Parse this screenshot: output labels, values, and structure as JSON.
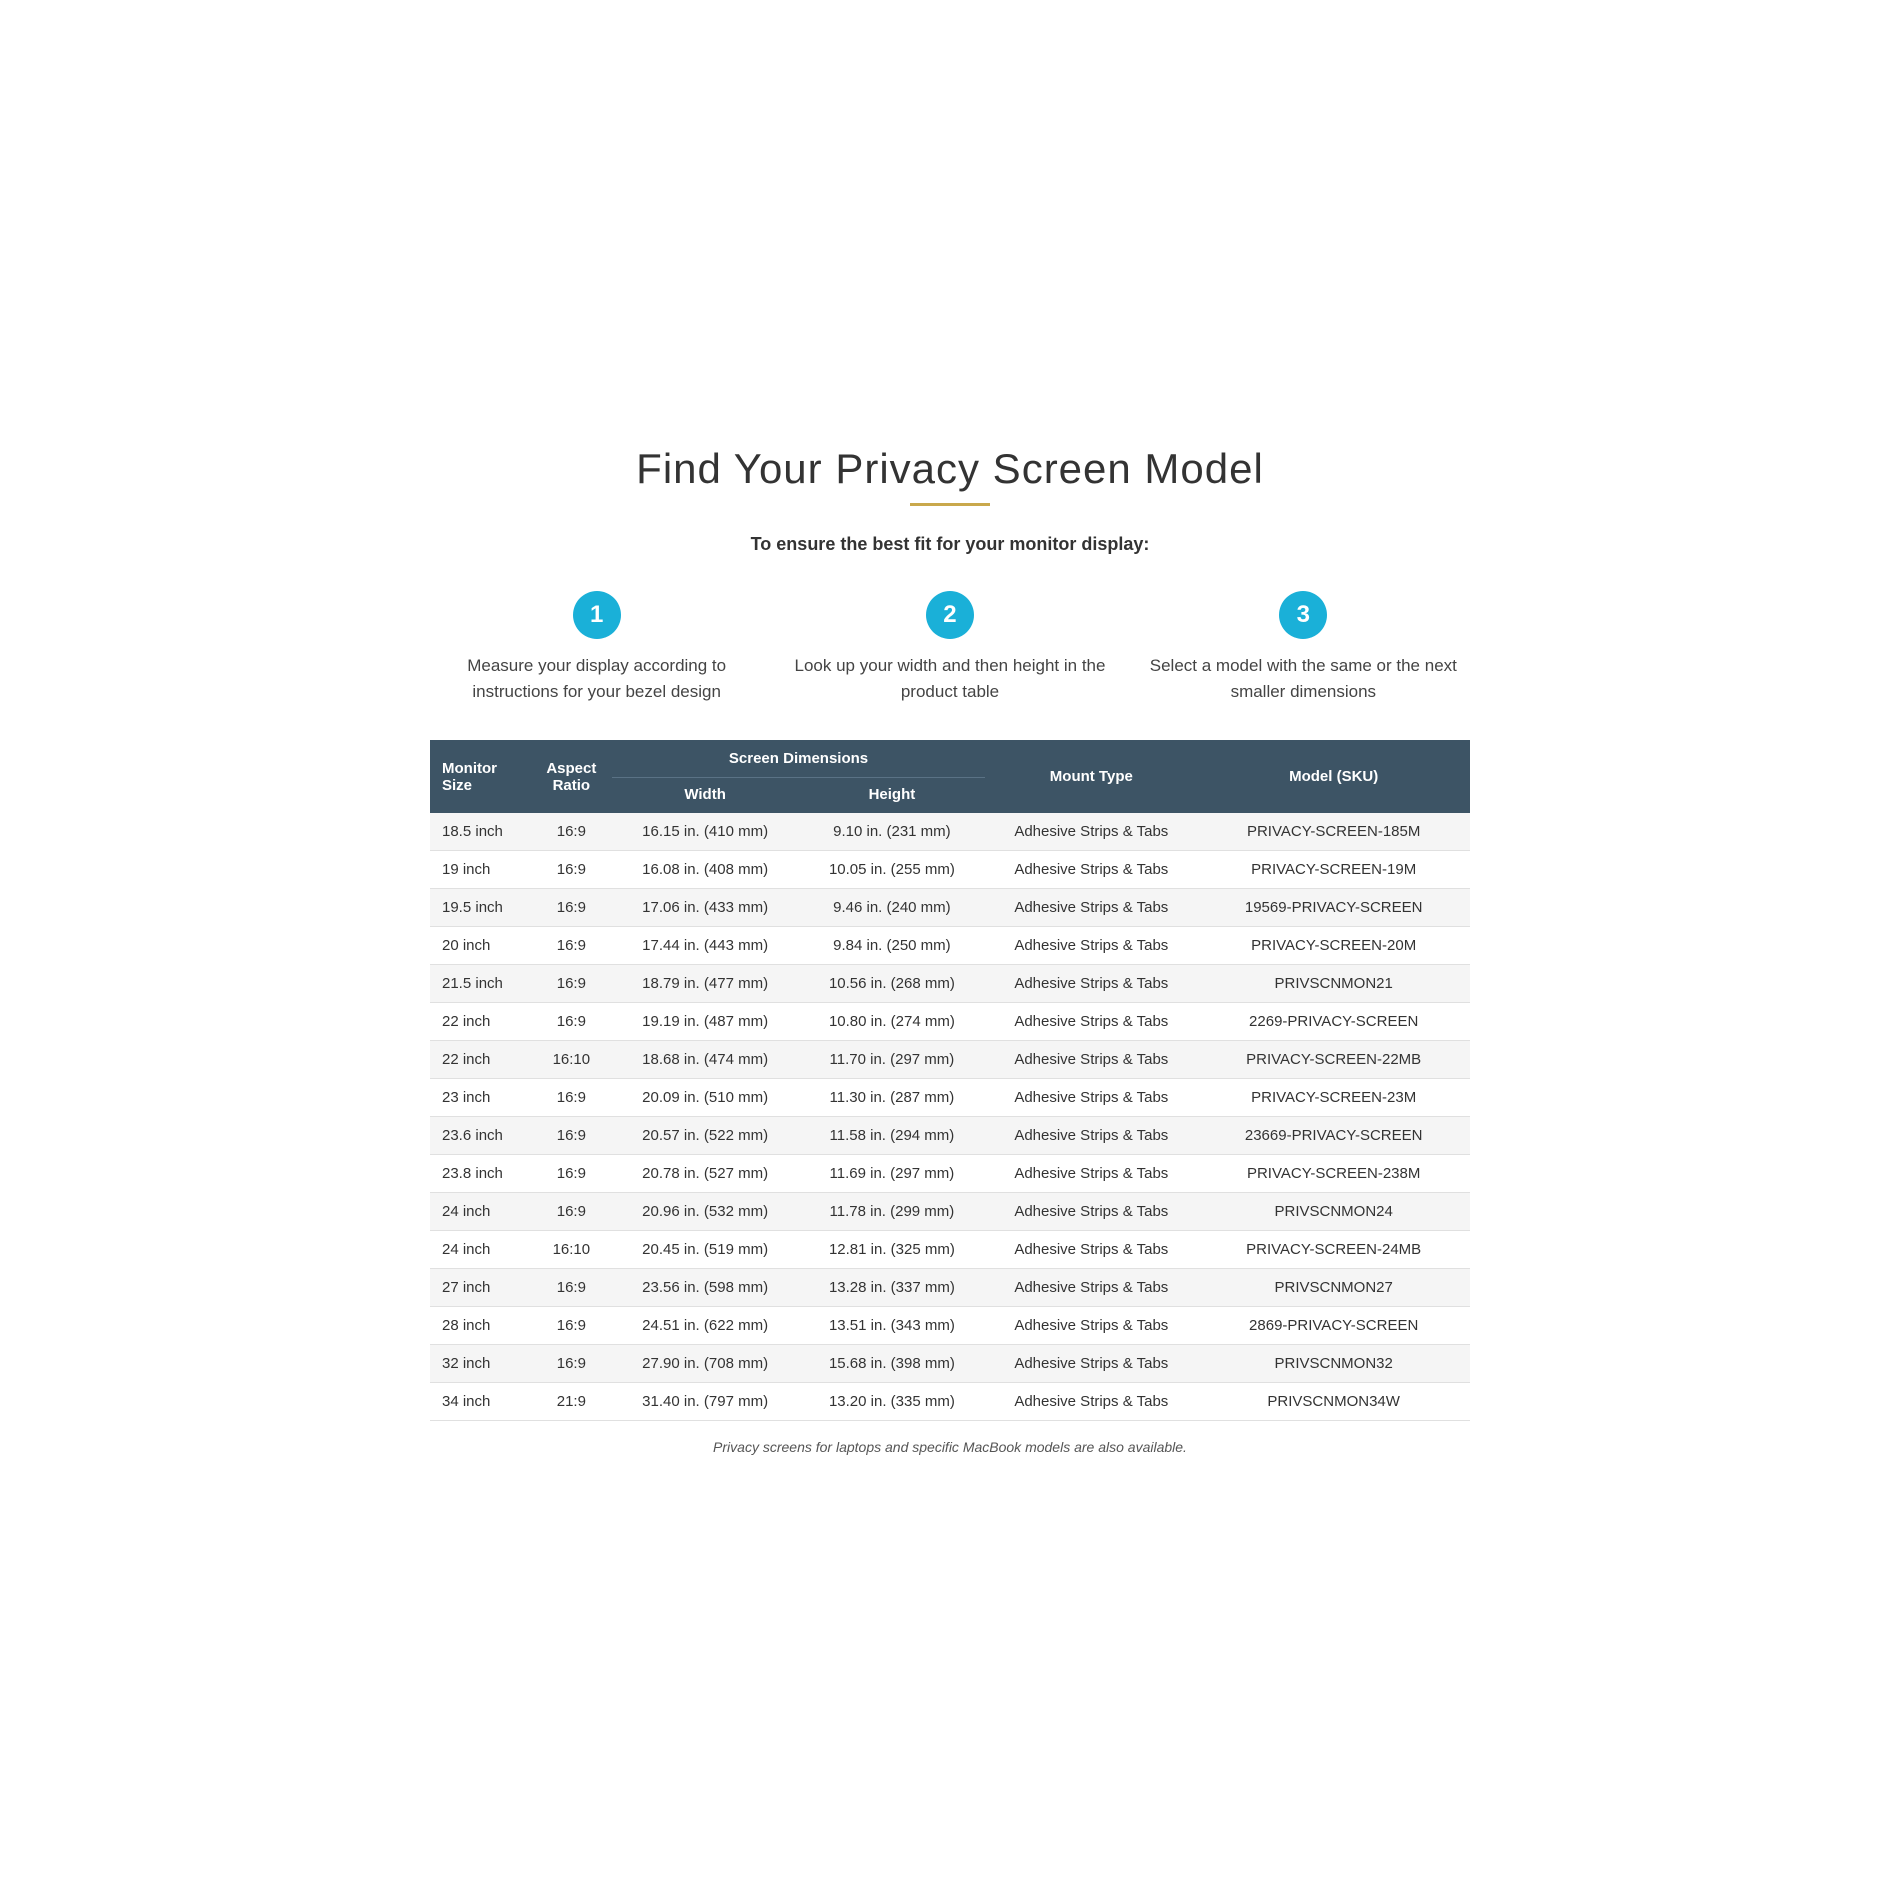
{
  "title": "Find Your Privacy Screen Model",
  "subtitle": "To ensure the best fit for your monitor display:",
  "steps": [
    {
      "number": "1",
      "text": "Measure your display according to instructions for your bezel design"
    },
    {
      "number": "2",
      "text": "Look up your width and then height in the product table"
    },
    {
      "number": "3",
      "text": "Select a model with the same or the next smaller dimensions"
    }
  ],
  "table": {
    "header_top": {
      "monitor_size": "Monitor Size",
      "aspect_ratio": "Aspect Ratio",
      "screen_dimensions": "Screen Dimensions",
      "mount_type": "Mount Type",
      "model_sku": "Model (SKU)"
    },
    "header_sub": {
      "width": "Width",
      "height": "Height"
    },
    "rows": [
      {
        "size": "18.5 inch",
        "aspect": "16:9",
        "width": "16.15 in. (410 mm)",
        "height": "9.10 in. (231 mm)",
        "mount": "Adhesive Strips & Tabs",
        "model": "PRIVACY-SCREEN-185M"
      },
      {
        "size": "19 inch",
        "aspect": "16:9",
        "width": "16.08 in. (408 mm)",
        "height": "10.05 in. (255 mm)",
        "mount": "Adhesive Strips & Tabs",
        "model": "PRIVACY-SCREEN-19M"
      },
      {
        "size": "19.5 inch",
        "aspect": "16:9",
        "width": "17.06 in. (433 mm)",
        "height": "9.46 in. (240 mm)",
        "mount": "Adhesive Strips & Tabs",
        "model": "19569-PRIVACY-SCREEN"
      },
      {
        "size": "20 inch",
        "aspect": "16:9",
        "width": "17.44 in. (443 mm)",
        "height": "9.84 in. (250 mm)",
        "mount": "Adhesive Strips & Tabs",
        "model": "PRIVACY-SCREEN-20M"
      },
      {
        "size": "21.5 inch",
        "aspect": "16:9",
        "width": "18.79 in. (477 mm)",
        "height": "10.56 in. (268 mm)",
        "mount": "Adhesive Strips & Tabs",
        "model": "PRIVSCNMON21"
      },
      {
        "size": "22 inch",
        "aspect": "16:9",
        "width": "19.19 in. (487 mm)",
        "height": "10.80 in. (274 mm)",
        "mount": "Adhesive Strips & Tabs",
        "model": "2269-PRIVACY-SCREEN"
      },
      {
        "size": "22 inch",
        "aspect": "16:10",
        "width": "18.68 in. (474 mm)",
        "height": "11.70 in. (297 mm)",
        "mount": "Adhesive Strips & Tabs",
        "model": "PRIVACY-SCREEN-22MB"
      },
      {
        "size": "23 inch",
        "aspect": "16:9",
        "width": "20.09 in. (510 mm)",
        "height": "11.30 in. (287 mm)",
        "mount": "Adhesive Strips & Tabs",
        "model": "PRIVACY-SCREEN-23M"
      },
      {
        "size": "23.6 inch",
        "aspect": "16:9",
        "width": "20.57 in. (522 mm)",
        "height": "11.58 in. (294 mm)",
        "mount": "Adhesive Strips & Tabs",
        "model": "23669-PRIVACY-SCREEN"
      },
      {
        "size": "23.8 inch",
        "aspect": "16:9",
        "width": "20.78 in. (527 mm)",
        "height": "11.69 in. (297 mm)",
        "mount": "Adhesive Strips & Tabs",
        "model": "PRIVACY-SCREEN-238M"
      },
      {
        "size": "24 inch",
        "aspect": "16:9",
        "width": "20.96 in. (532 mm)",
        "height": "11.78 in. (299 mm)",
        "mount": "Adhesive Strips & Tabs",
        "model": "PRIVSCNMON24"
      },
      {
        "size": "24 inch",
        "aspect": "16:10",
        "width": "20.45 in. (519 mm)",
        "height": "12.81 in. (325 mm)",
        "mount": "Adhesive Strips & Tabs",
        "model": "PRIVACY-SCREEN-24MB"
      },
      {
        "size": "27 inch",
        "aspect": "16:9",
        "width": "23.56 in. (598 mm)",
        "height": "13.28 in. (337 mm)",
        "mount": "Adhesive Strips & Tabs",
        "model": "PRIVSCNMON27"
      },
      {
        "size": "28 inch",
        "aspect": "16:9",
        "width": "24.51 in. (622 mm)",
        "height": "13.51 in. (343 mm)",
        "mount": "Adhesive Strips & Tabs",
        "model": "2869-PRIVACY-SCREEN"
      },
      {
        "size": "32 inch",
        "aspect": "16:9",
        "width": "27.90 in. (708 mm)",
        "height": "15.68 in. (398 mm)",
        "mount": "Adhesive Strips & Tabs",
        "model": "PRIVSCNMON32"
      },
      {
        "size": "34 inch",
        "aspect": "21:9",
        "width": "31.40 in. (797 mm)",
        "height": "13.20 in. (335 mm)",
        "mount": "Adhesive Strips & Tabs",
        "model": "PRIVSCNMON34W"
      }
    ]
  },
  "footer": "Privacy screens for laptops and specific MacBook models are also available."
}
